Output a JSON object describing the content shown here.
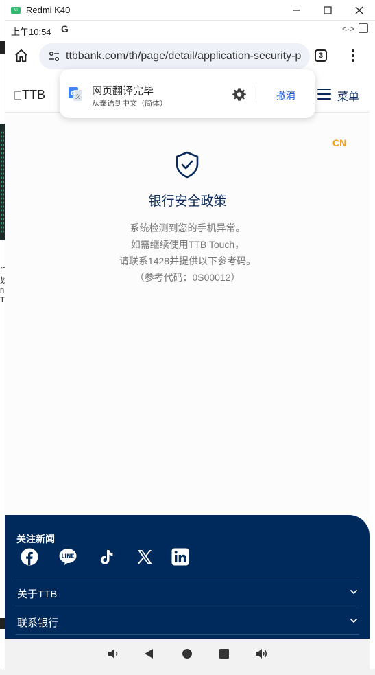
{
  "window": {
    "title": "Redmi K40",
    "icon_label": "MI",
    "minimize": "—",
    "maximize": "☐",
    "close": "✕"
  },
  "status_bar": {
    "time": "上午10:54",
    "g_icon": "G",
    "right_icon": "<·>"
  },
  "browser": {
    "url": "ttbbank.com/th/page/detail/application-security-p",
    "tab_count": "3"
  },
  "page_header": {
    "logo_alt": "TTB",
    "menu_label": "菜单"
  },
  "translate_popup": {
    "title": "网页翻译完毕",
    "subtitle": "从泰语到中文（简体）",
    "cancel_label": "撤消"
  },
  "content": {
    "lang_tag": "CN",
    "title": "银行安全政策",
    "lines": [
      "系统检测到您的手机异常。",
      "如需继续使用TTB Touch，",
      "请联系1428并提供以下参考码。",
      "（参考代码：0S00012）"
    ]
  },
  "footer": {
    "follow_label": "关注新闻",
    "socials": [
      "facebook-icon",
      "line-icon",
      "tiktok-icon",
      "x-icon",
      "linkedin-icon"
    ],
    "rows": [
      {
        "label": "关于TTB"
      },
      {
        "label": "联系银行"
      }
    ]
  },
  "colors": {
    "brand_navy": "#0a2a5c",
    "footer_bg": "#002a5c",
    "accent_orange": "#f39c12",
    "link_blue": "#1a5bd6"
  },
  "desktop_fragments": {
    "text": "门\n划\nn\nT"
  }
}
